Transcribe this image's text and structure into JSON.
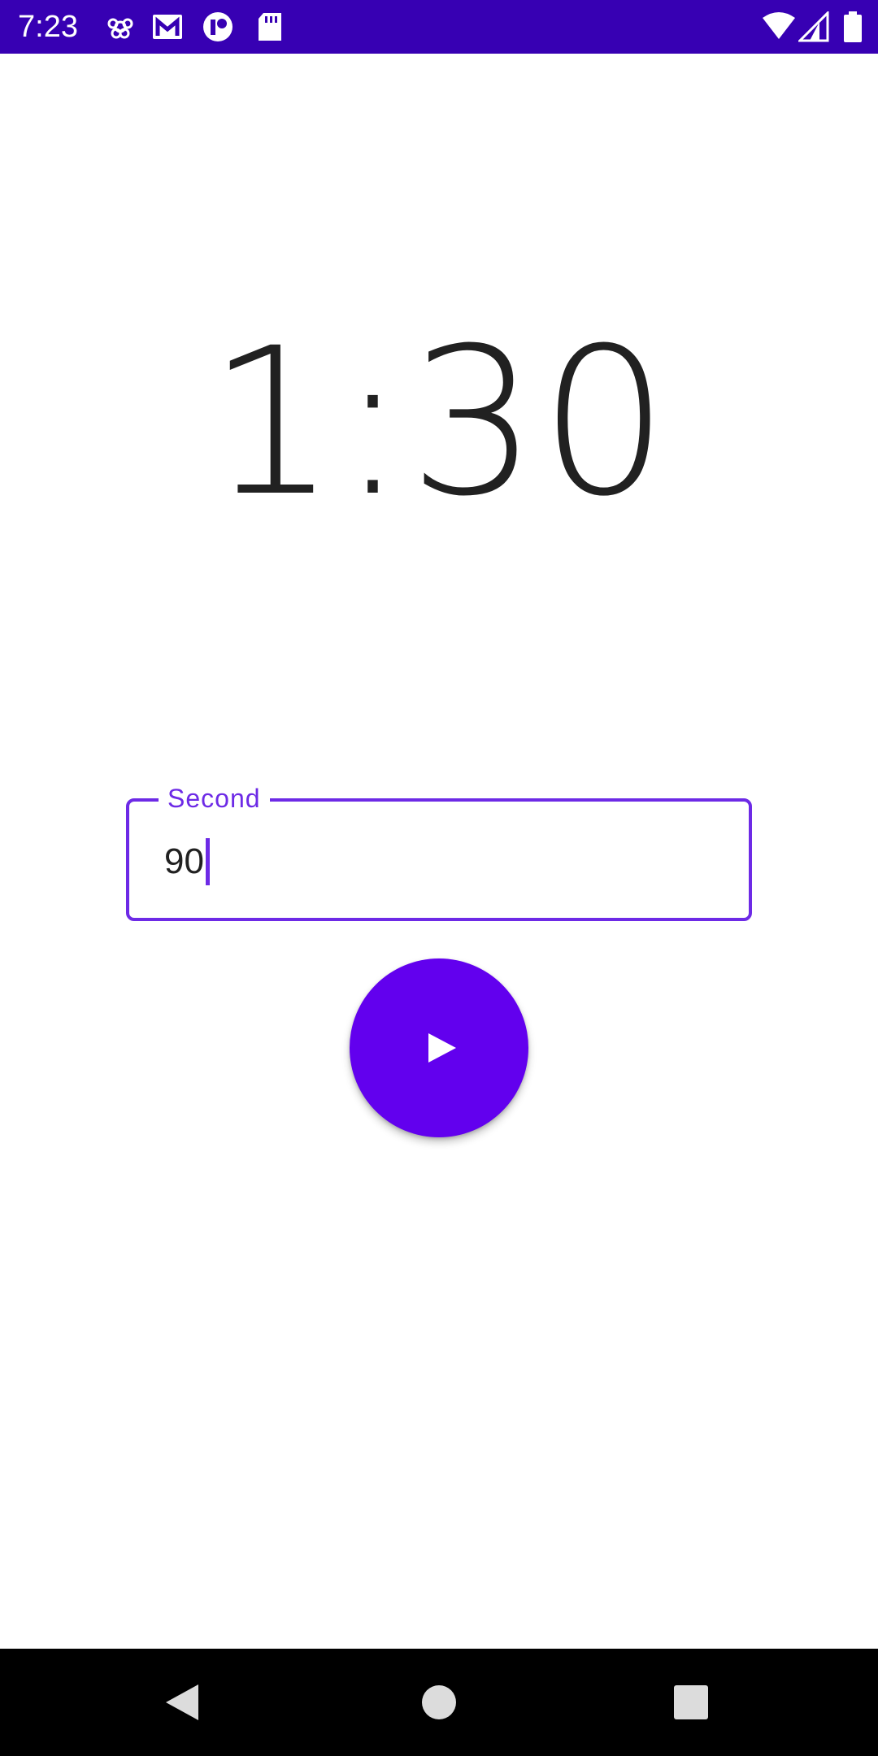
{
  "status_bar": {
    "time": "7:23",
    "background_color": "#3700b3",
    "left_icons": [
      "app-notification-icon",
      "gmail-icon",
      "notification-icon",
      "sd-card-icon"
    ],
    "right_icons": [
      "wifi-icon",
      "cell-signal-icon",
      "battery-icon"
    ]
  },
  "timer": {
    "display": "1:30"
  },
  "seconds_field": {
    "label": "Second",
    "value": "90",
    "accent_color": "#6d2ae6"
  },
  "start_button": {
    "icon": "play-icon",
    "color": "#6200ee"
  },
  "nav_bar": {
    "buttons": [
      "back-icon",
      "home-icon",
      "recents-icon"
    ]
  }
}
